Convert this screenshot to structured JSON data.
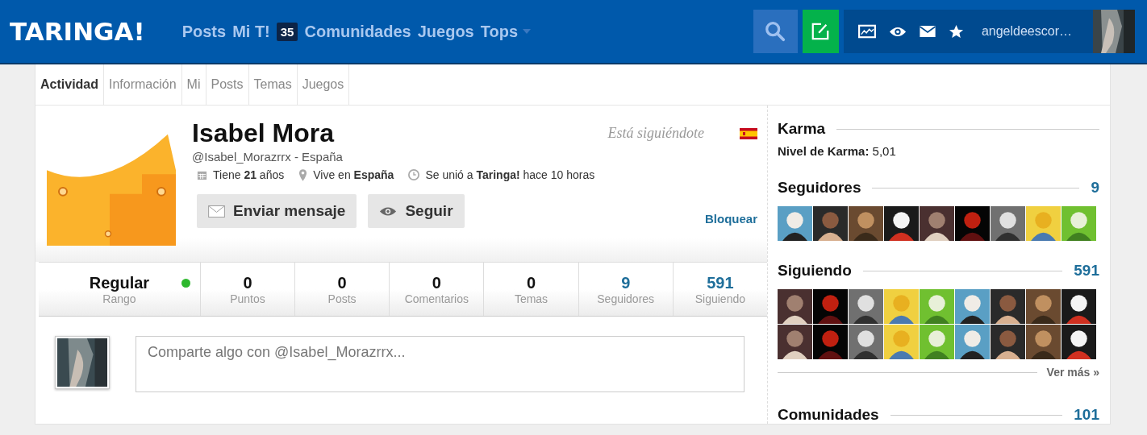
{
  "header": {
    "logo": "TARINGA!",
    "nav": [
      {
        "label": "Posts",
        "kind": "link"
      },
      {
        "label": "Mi T!",
        "kind": "link"
      },
      {
        "label": "35",
        "kind": "badge"
      },
      {
        "label": "Comunidades",
        "kind": "link"
      },
      {
        "label": "Juegos",
        "kind": "link"
      },
      {
        "label": "Tops",
        "kind": "dropdown"
      }
    ],
    "username": "angeldeescor…"
  },
  "tabs": [
    {
      "label": "Actividad",
      "selected": true
    },
    {
      "label": "Información",
      "selected": false
    },
    {
      "label": "Mi",
      "selected": false
    },
    {
      "label": "Posts",
      "selected": false
    },
    {
      "label": "Temas",
      "selected": false
    },
    {
      "label": "Juegos",
      "selected": false
    }
  ],
  "profile": {
    "name": "Isabel Mora",
    "following_you": "Está siguiéndote",
    "handle": "@Isabel_Morazrrx - España",
    "facts": [
      {
        "kind": "age",
        "text": "Tiene **21** años"
      },
      {
        "kind": "location",
        "text": "Vive en **España**"
      },
      {
        "kind": "joined",
        "text": "Se unió a **Taringa!** hace 10 horas"
      }
    ],
    "buttons": [
      {
        "kind": "message",
        "label": "Enviar mensaje"
      },
      {
        "kind": "follow",
        "label": "Seguir"
      }
    ],
    "block": "Bloquear"
  },
  "stats": [
    {
      "value": "Regular",
      "label": "Rango",
      "online": true,
      "link": false
    },
    {
      "value": "0",
      "label": "Puntos",
      "link": false
    },
    {
      "value": "0",
      "label": "Posts",
      "link": false
    },
    {
      "value": "0",
      "label": "Comentarios",
      "link": false
    },
    {
      "value": "0",
      "label": "Temas",
      "link": false
    },
    {
      "value": "9",
      "label": "Seguidores",
      "link": true
    },
    {
      "value": "591",
      "label": "Siguiendo",
      "link": true
    }
  ],
  "share": {
    "placeholder": "Comparte algo con @Isabel_Morazrrx..."
  },
  "sidebar": {
    "karma": {
      "title": "Karma",
      "label": "Nivel de Karma:",
      "value": "5,01"
    },
    "followers": {
      "title": "Seguidores",
      "count": "9"
    },
    "following": {
      "title": "Siguiendo",
      "count": "591",
      "more": "Ver más »"
    },
    "communities": {
      "title": "Comunidades",
      "count": "101"
    }
  }
}
